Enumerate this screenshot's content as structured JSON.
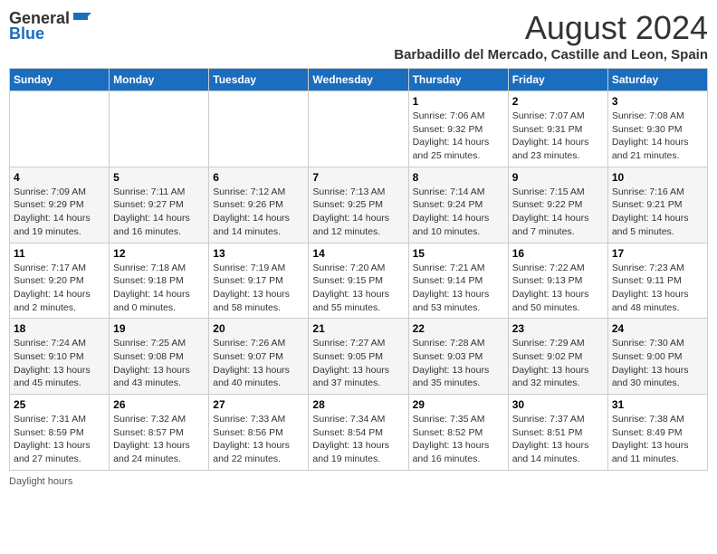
{
  "header": {
    "logo_general": "General",
    "logo_blue": "Blue",
    "title": "August 2024",
    "subtitle": "Barbadillo del Mercado, Castille and Leon, Spain"
  },
  "days_of_week": [
    "Sunday",
    "Monday",
    "Tuesday",
    "Wednesday",
    "Thursday",
    "Friday",
    "Saturday"
  ],
  "weeks": [
    [
      {
        "day": "",
        "info": ""
      },
      {
        "day": "",
        "info": ""
      },
      {
        "day": "",
        "info": ""
      },
      {
        "day": "",
        "info": ""
      },
      {
        "day": "1",
        "info": "Sunrise: 7:06 AM\nSunset: 9:32 PM\nDaylight: 14 hours and 25 minutes."
      },
      {
        "day": "2",
        "info": "Sunrise: 7:07 AM\nSunset: 9:31 PM\nDaylight: 14 hours and 23 minutes."
      },
      {
        "day": "3",
        "info": "Sunrise: 7:08 AM\nSunset: 9:30 PM\nDaylight: 14 hours and 21 minutes."
      }
    ],
    [
      {
        "day": "4",
        "info": "Sunrise: 7:09 AM\nSunset: 9:29 PM\nDaylight: 14 hours and 19 minutes."
      },
      {
        "day": "5",
        "info": "Sunrise: 7:11 AM\nSunset: 9:27 PM\nDaylight: 14 hours and 16 minutes."
      },
      {
        "day": "6",
        "info": "Sunrise: 7:12 AM\nSunset: 9:26 PM\nDaylight: 14 hours and 14 minutes."
      },
      {
        "day": "7",
        "info": "Sunrise: 7:13 AM\nSunset: 9:25 PM\nDaylight: 14 hours and 12 minutes."
      },
      {
        "day": "8",
        "info": "Sunrise: 7:14 AM\nSunset: 9:24 PM\nDaylight: 14 hours and 10 minutes."
      },
      {
        "day": "9",
        "info": "Sunrise: 7:15 AM\nSunset: 9:22 PM\nDaylight: 14 hours and 7 minutes."
      },
      {
        "day": "10",
        "info": "Sunrise: 7:16 AM\nSunset: 9:21 PM\nDaylight: 14 hours and 5 minutes."
      }
    ],
    [
      {
        "day": "11",
        "info": "Sunrise: 7:17 AM\nSunset: 9:20 PM\nDaylight: 14 hours and 2 minutes."
      },
      {
        "day": "12",
        "info": "Sunrise: 7:18 AM\nSunset: 9:18 PM\nDaylight: 14 hours and 0 minutes."
      },
      {
        "day": "13",
        "info": "Sunrise: 7:19 AM\nSunset: 9:17 PM\nDaylight: 13 hours and 58 minutes."
      },
      {
        "day": "14",
        "info": "Sunrise: 7:20 AM\nSunset: 9:15 PM\nDaylight: 13 hours and 55 minutes."
      },
      {
        "day": "15",
        "info": "Sunrise: 7:21 AM\nSunset: 9:14 PM\nDaylight: 13 hours and 53 minutes."
      },
      {
        "day": "16",
        "info": "Sunrise: 7:22 AM\nSunset: 9:13 PM\nDaylight: 13 hours and 50 minutes."
      },
      {
        "day": "17",
        "info": "Sunrise: 7:23 AM\nSunset: 9:11 PM\nDaylight: 13 hours and 48 minutes."
      }
    ],
    [
      {
        "day": "18",
        "info": "Sunrise: 7:24 AM\nSunset: 9:10 PM\nDaylight: 13 hours and 45 minutes."
      },
      {
        "day": "19",
        "info": "Sunrise: 7:25 AM\nSunset: 9:08 PM\nDaylight: 13 hours and 43 minutes."
      },
      {
        "day": "20",
        "info": "Sunrise: 7:26 AM\nSunset: 9:07 PM\nDaylight: 13 hours and 40 minutes."
      },
      {
        "day": "21",
        "info": "Sunrise: 7:27 AM\nSunset: 9:05 PM\nDaylight: 13 hours and 37 minutes."
      },
      {
        "day": "22",
        "info": "Sunrise: 7:28 AM\nSunset: 9:03 PM\nDaylight: 13 hours and 35 minutes."
      },
      {
        "day": "23",
        "info": "Sunrise: 7:29 AM\nSunset: 9:02 PM\nDaylight: 13 hours and 32 minutes."
      },
      {
        "day": "24",
        "info": "Sunrise: 7:30 AM\nSunset: 9:00 PM\nDaylight: 13 hours and 30 minutes."
      }
    ],
    [
      {
        "day": "25",
        "info": "Sunrise: 7:31 AM\nSunset: 8:59 PM\nDaylight: 13 hours and 27 minutes."
      },
      {
        "day": "26",
        "info": "Sunrise: 7:32 AM\nSunset: 8:57 PM\nDaylight: 13 hours and 24 minutes."
      },
      {
        "day": "27",
        "info": "Sunrise: 7:33 AM\nSunset: 8:56 PM\nDaylight: 13 hours and 22 minutes."
      },
      {
        "day": "28",
        "info": "Sunrise: 7:34 AM\nSunset: 8:54 PM\nDaylight: 13 hours and 19 minutes."
      },
      {
        "day": "29",
        "info": "Sunrise: 7:35 AM\nSunset: 8:52 PM\nDaylight: 13 hours and 16 minutes."
      },
      {
        "day": "30",
        "info": "Sunrise: 7:37 AM\nSunset: 8:51 PM\nDaylight: 13 hours and 14 minutes."
      },
      {
        "day": "31",
        "info": "Sunrise: 7:38 AM\nSunset: 8:49 PM\nDaylight: 13 hours and 11 minutes."
      }
    ]
  ],
  "footer": {
    "daylight_label": "Daylight hours"
  }
}
